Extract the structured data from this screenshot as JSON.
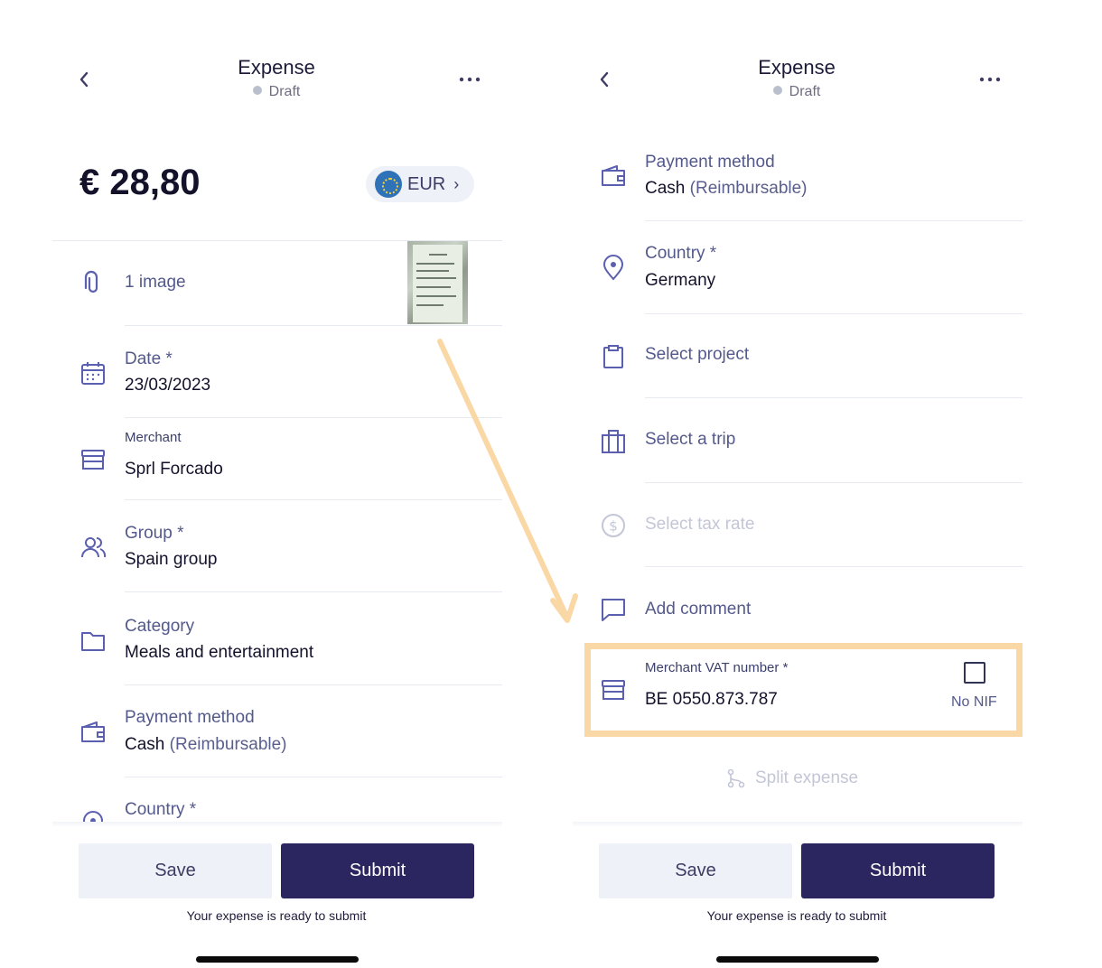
{
  "colors": {
    "accent": "#2c2660",
    "highlight": "#fad8a6",
    "label": "#54598c"
  },
  "header": {
    "title": "Expense",
    "status": "Draft",
    "back_icon": "chevron-left-icon",
    "more_icon": "more-icon"
  },
  "left": {
    "amount": "€ 28,80",
    "currency": "EUR",
    "attachments_label": "1 image",
    "date_label": "Date *",
    "date_value": "23/03/2023",
    "merchant_label": "Merchant",
    "merchant_value": "Sprl Forcado",
    "group_label": "Group *",
    "group_value": "Spain group",
    "category_label": "Category",
    "category_value": "Meals and entertainment",
    "payment_label": "Payment method",
    "payment_value": "Cash",
    "payment_suffix": "(Reimbursable)",
    "country_label": "Country *"
  },
  "right": {
    "payment_label": "Payment method",
    "payment_value": "Cash",
    "payment_suffix": "(Reimbursable)",
    "country_label": "Country *",
    "country_value": "Germany",
    "project_label": "Select project",
    "trip_label": "Select a trip",
    "tax_label": "Select tax rate",
    "comment_label": "Add comment",
    "vat_label": "Merchant VAT number *",
    "vat_value": "BE 0550.873.787",
    "no_nif_label": "No NIF",
    "split_label": "Split expense"
  },
  "footer": {
    "save_label": "Save",
    "submit_label": "Submit",
    "ready_text": "Your expense is ready to submit"
  }
}
